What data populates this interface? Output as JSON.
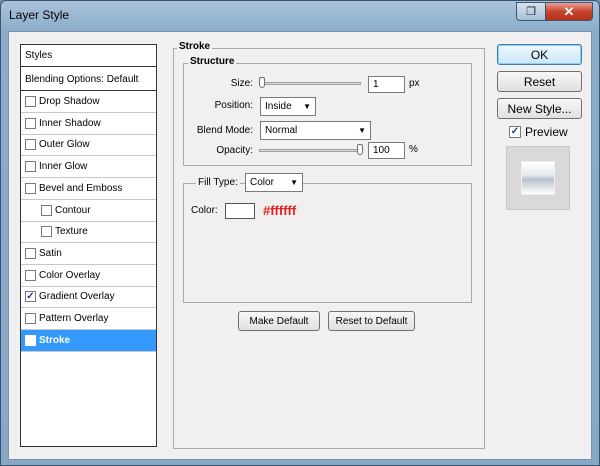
{
  "window": {
    "title": "Layer Style",
    "restore_glyph": "❐",
    "close_glyph": "✕"
  },
  "styles_panel": {
    "header": "Styles",
    "blending": "Blending Options: Default",
    "items": [
      {
        "label": "Drop Shadow",
        "checked": false,
        "indent": false,
        "selected": false
      },
      {
        "label": "Inner Shadow",
        "checked": false,
        "indent": false,
        "selected": false
      },
      {
        "label": "Outer Glow",
        "checked": false,
        "indent": false,
        "selected": false
      },
      {
        "label": "Inner Glow",
        "checked": false,
        "indent": false,
        "selected": false
      },
      {
        "label": "Bevel and Emboss",
        "checked": false,
        "indent": false,
        "selected": false
      },
      {
        "label": "Contour",
        "checked": false,
        "indent": true,
        "selected": false
      },
      {
        "label": "Texture",
        "checked": false,
        "indent": true,
        "selected": false
      },
      {
        "label": "Satin",
        "checked": false,
        "indent": false,
        "selected": false
      },
      {
        "label": "Color Overlay",
        "checked": false,
        "indent": false,
        "selected": false
      },
      {
        "label": "Gradient Overlay",
        "checked": true,
        "indent": false,
        "selected": false
      },
      {
        "label": "Pattern Overlay",
        "checked": false,
        "indent": false,
        "selected": false
      },
      {
        "label": "Stroke",
        "checked": true,
        "indent": false,
        "selected": true
      }
    ]
  },
  "stroke": {
    "title": "Stroke",
    "structure": {
      "title": "Structure",
      "size_label": "Size:",
      "size_value": "1",
      "size_unit": "px",
      "position_label": "Position:",
      "position_value": "Inside",
      "blend_label": "Blend Mode:",
      "blend_value": "Normal",
      "opacity_label": "Opacity:",
      "opacity_value": "100",
      "opacity_unit": "%",
      "size_level": 0,
      "opacity_level": 100
    },
    "fill_type_label": "Fill Type:",
    "fill_type_value": "Color",
    "color_label": "Color:",
    "color_value": "#ffffff",
    "color_annotation": "#ffffff",
    "make_default": "Make Default",
    "reset_default": "Reset to Default"
  },
  "buttons": {
    "ok": "OK",
    "reset": "Reset",
    "new_style": "New Style...",
    "preview_label": "Preview",
    "preview_checked": true
  },
  "colors": {
    "selection": "#3399ff",
    "annotation": "#e11f1f"
  }
}
